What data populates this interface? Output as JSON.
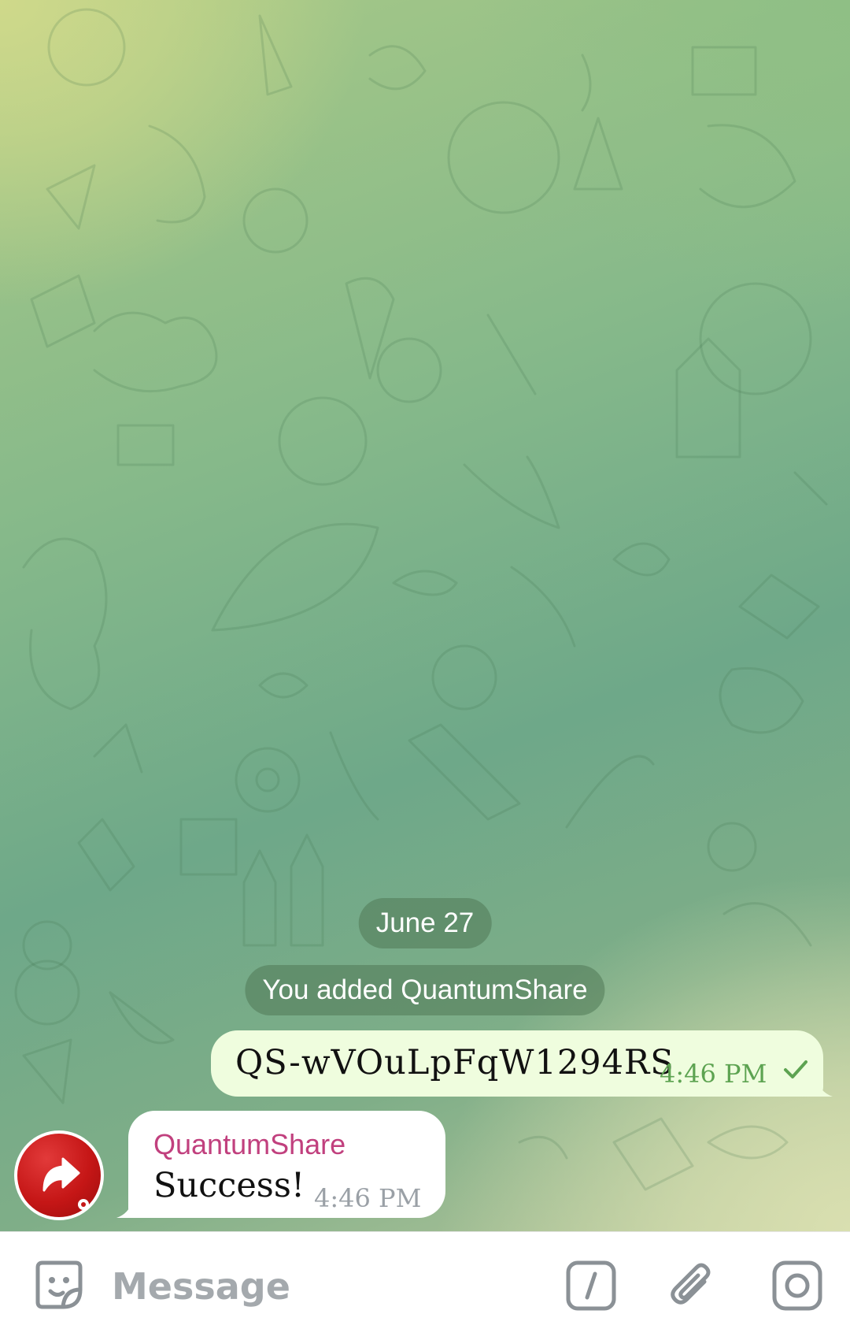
{
  "chat": {
    "date_separator": "June 27",
    "service_message": "You added QuantumShare",
    "messages": [
      {
        "direction": "outgoing",
        "text": "QS-wVOuLpFqW1294RS",
        "time": "4:46 PM",
        "status": "sent-check-icon"
      },
      {
        "direction": "incoming",
        "sender": "QuantumShare",
        "text": "Success!",
        "time": "4:46 PM",
        "avatar": "share-arrow-icon"
      }
    ]
  },
  "input_bar": {
    "placeholder": "Message",
    "icons": [
      "sticker-icon",
      "bot-command-icon",
      "attach-icon",
      "camera-icon"
    ]
  },
  "colors": {
    "outgoing_bubble": "#effdde",
    "outgoing_time": "#5da351",
    "sender_name": "#c1407e",
    "incoming_time": "#9aa0a6",
    "avatar_red": "#c51616"
  }
}
